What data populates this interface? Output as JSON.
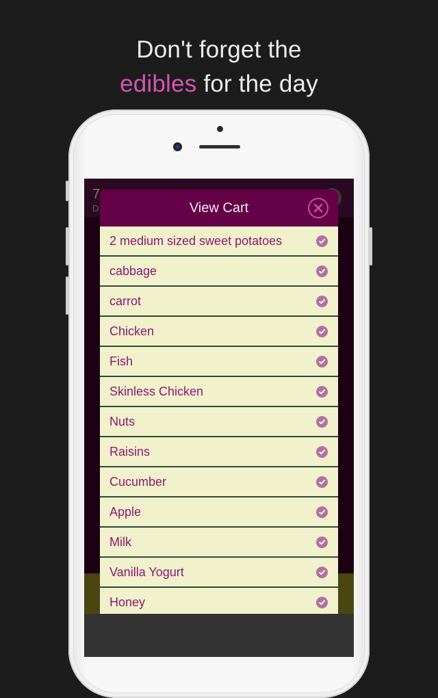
{
  "headline": {
    "line1": "Don't forget the",
    "accent": "edibles",
    "line2_rest": " for the day"
  },
  "background_screen": {
    "top_number": "7",
    "top_letter": "D"
  },
  "modal": {
    "title": "View Cart",
    "close_icon": "close-circle-icon",
    "items": [
      {
        "label": "2 medium sized sweet potatoes",
        "checked": true
      },
      {
        "label": "cabbage",
        "checked": true
      },
      {
        "label": "carrot",
        "checked": true
      },
      {
        "label": "Chicken",
        "checked": true
      },
      {
        "label": "Fish",
        "checked": true
      },
      {
        "label": "Skinless Chicken",
        "checked": true
      },
      {
        "label": "Nuts",
        "checked": true
      },
      {
        "label": "Raisins",
        "checked": true
      },
      {
        "label": "Cucumber",
        "checked": true
      },
      {
        "label": "Apple",
        "checked": true
      },
      {
        "label": "Milk",
        "checked": true
      },
      {
        "label": "Vanilla Yogurt",
        "checked": true
      },
      {
        "label": "Honey",
        "checked": true
      }
    ]
  },
  "colors": {
    "accent_pink": "#d455b4",
    "header_purple": "#650146",
    "item_bg": "#f1f1cc",
    "item_text": "#8e1770",
    "check_bg": "#b2719f"
  }
}
